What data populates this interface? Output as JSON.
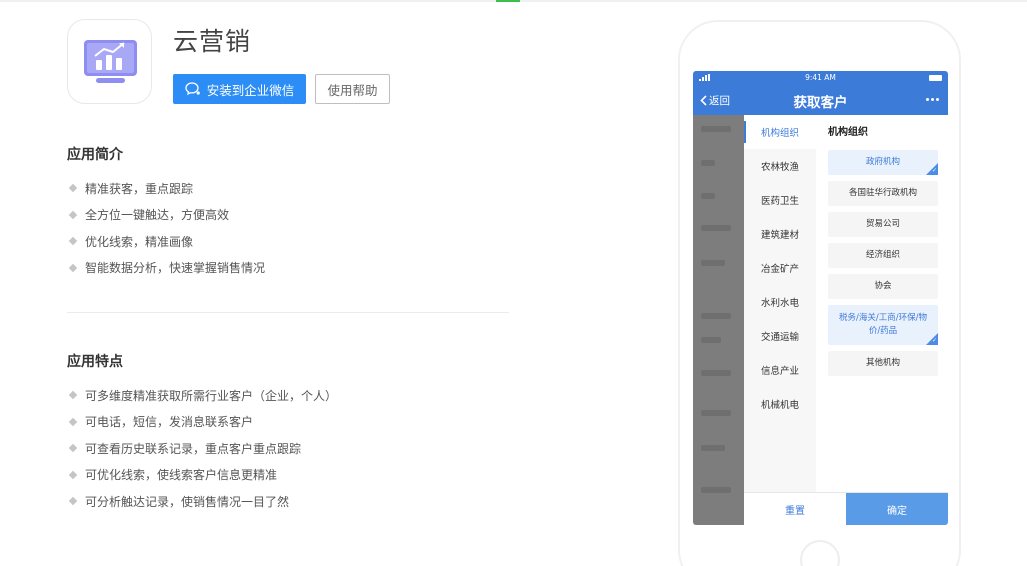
{
  "app": {
    "title": "云营销",
    "install_label": "安装到企业微信",
    "help_label": "使用帮助",
    "icon": "analytics-monitor-icon",
    "accent_color": "#2b8df5"
  },
  "intro": {
    "title": "应用简介",
    "items": [
      "精准获客，重点跟踪",
      "全方位一键触达，方便高效",
      "优化线索，精准画像",
      "智能数据分析，快速掌握销售情况"
    ]
  },
  "features": {
    "title": "应用特点",
    "items": [
      "可多维度精准获取所需行业客户（企业，个人）",
      "可电话，短信，发消息联系客户",
      "可查看历史联系记录，重点客户重点跟踪",
      "可优化线索，使线索客户信息更精准",
      "可分析触达记录，使销售情况一目了然"
    ]
  },
  "phone": {
    "status_time": "9:41 AM",
    "nav_back": "返回",
    "nav_title": "获取客户",
    "categories": [
      "机构组织",
      "农林牧渔",
      "医药卫生",
      "建筑建材",
      "冶金矿产",
      "水利水电",
      "交通运输",
      "信息产业",
      "机械机电"
    ],
    "active_category": "机构组织",
    "sub_heading": "机构组织",
    "subcategories": [
      {
        "label": "政府机构",
        "selected": true
      },
      {
        "label": "各国驻华行政机构",
        "selected": false
      },
      {
        "label": "贸易公司",
        "selected": false
      },
      {
        "label": "经济组织",
        "selected": false
      },
      {
        "label": "协会",
        "selected": false
      },
      {
        "label": "税务/海关/工商/环保/物价/药品",
        "selected": true
      },
      {
        "label": "其他机构",
        "selected": false
      }
    ],
    "reset_label": "重置",
    "confirm_label": "确定",
    "theme_color": "#3d7bd9"
  }
}
